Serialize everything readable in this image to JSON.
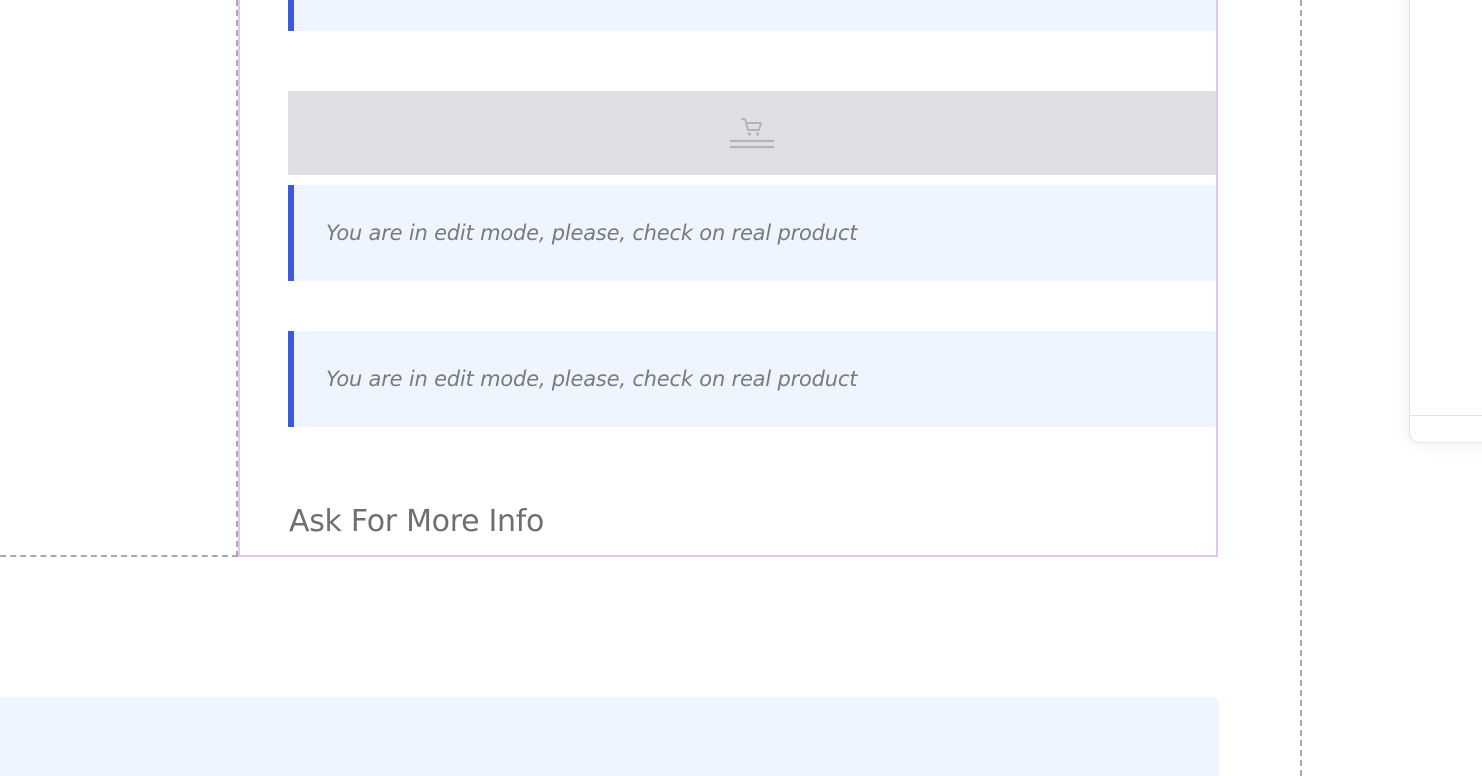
{
  "editor": {
    "notices": [
      {
        "text": "You are in edit mode, please, check on real product"
      },
      {
        "text": "You are in edit mode, please, check on real product"
      }
    ],
    "cart_widget": {
      "icon": "cart-icon"
    },
    "ask_section": {
      "title": "Ask For More Info"
    }
  },
  "colors": {
    "accent": "#3b5bdb",
    "notice_background": "#eff5fe",
    "placeholder_background": "#dfe0e4",
    "selection_outline": "#e2c6f2"
  }
}
